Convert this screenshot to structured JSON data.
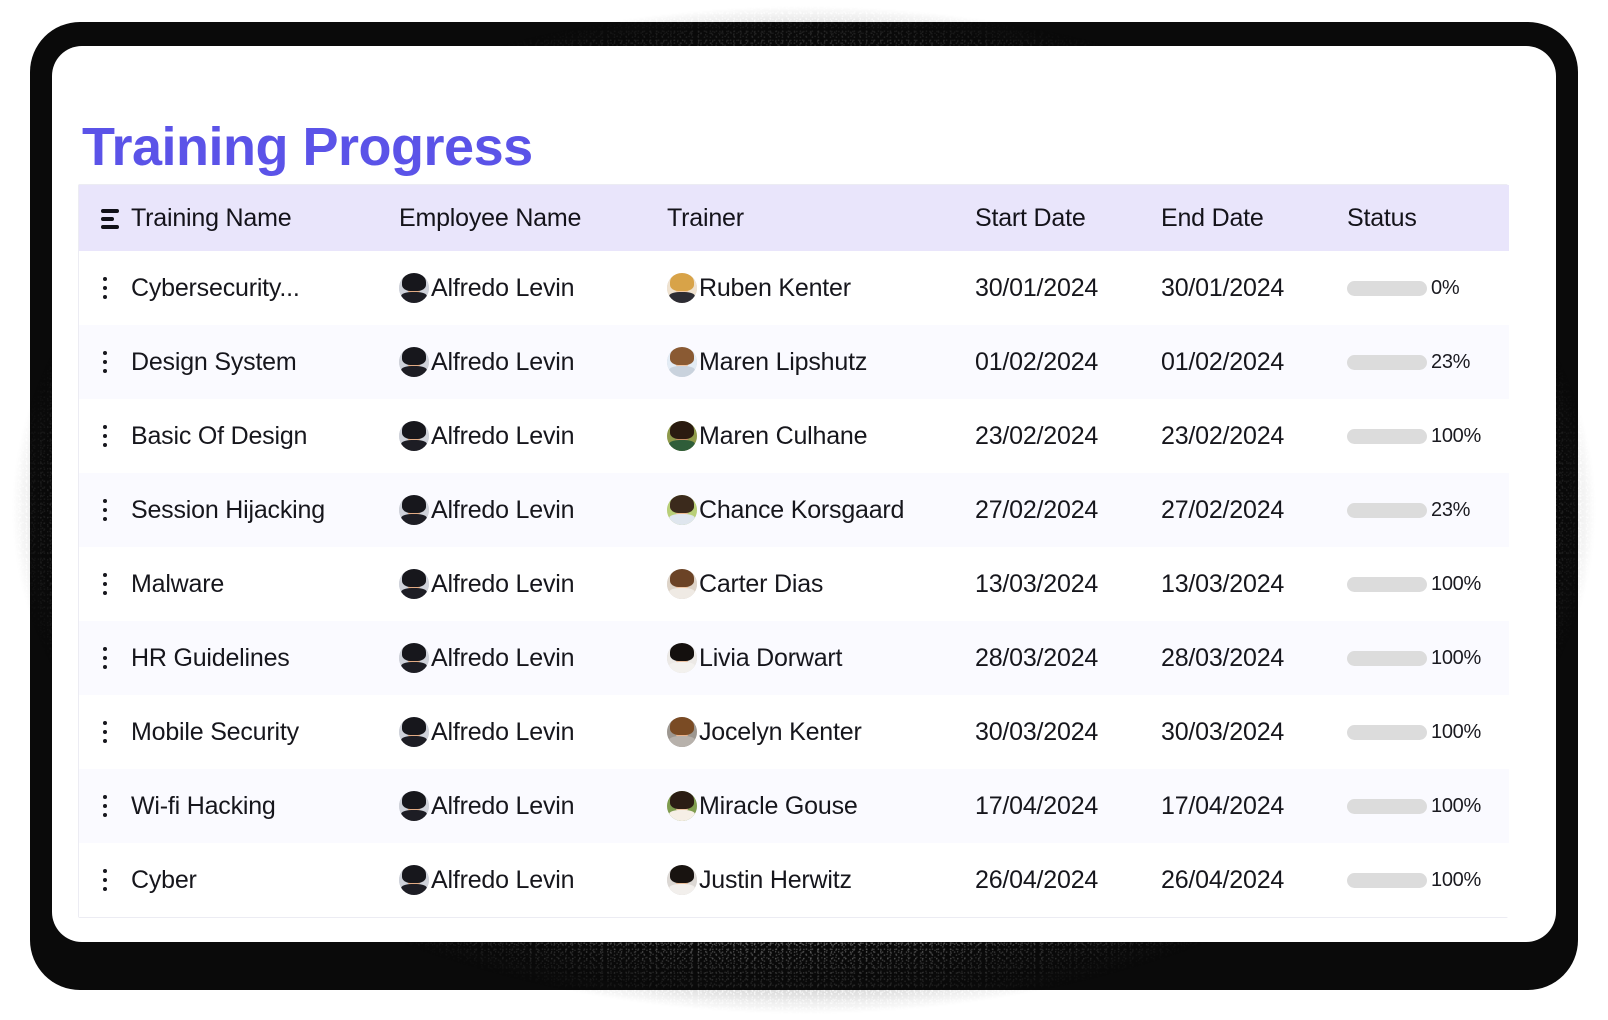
{
  "header": {
    "title": "Training Progress",
    "title_color": "#5b53e8"
  },
  "table": {
    "header_bg": "#e9e5fb",
    "sort_icon": "sort-lines-icon",
    "columns": [
      {
        "key": "handle",
        "label": ""
      },
      {
        "key": "training",
        "label": "Training Name"
      },
      {
        "key": "employee",
        "label": "Employee Name"
      },
      {
        "key": "trainer",
        "label": "Trainer"
      },
      {
        "key": "start",
        "label": "Start Date"
      },
      {
        "key": "end",
        "label": "End Date"
      },
      {
        "key": "status",
        "label": "Status"
      }
    ],
    "row_menu_icon": "kebab-menu-icon",
    "progress_colors": {
      "empty": "#dcdcdc",
      "partial": "#ffa800",
      "complete": "#22c91e"
    },
    "rows": [
      {
        "training": "Cybersecurity...",
        "employee": "Alfredo Levin",
        "trainer": "Ruben Kenter",
        "start": "30/01/2024",
        "end": "30/01/2024",
        "progress": 0,
        "progress_label": "0%",
        "bar_ratio": 0,
        "bar_color": "#dcdcdc",
        "emp_avatar": {
          "hair": "#17171c",
          "skin": "#e2ab84",
          "body": "#1d1d24",
          "bg": "#cfd2da"
        },
        "trainer_avatar": {
          "hair": "#d8a348",
          "skin": "#f1c9a4",
          "body": "#2c2c33",
          "bg": "#efe2cf"
        }
      },
      {
        "training": "Design System",
        "employee": "Alfredo Levin",
        "trainer": "Maren Lipshutz",
        "start": "01/02/2024",
        "end": "01/02/2024",
        "progress": 23,
        "progress_label": "23%",
        "bar_ratio": 0.52,
        "bar_color": "#ffa800",
        "emp_avatar": {
          "hair": "#17171c",
          "skin": "#e2ab84",
          "body": "#1d1d24",
          "bg": "#cfd2da"
        },
        "trainer_avatar": {
          "hair": "#8a5a33",
          "skin": "#f0c3a0",
          "body": "#c9d2dd",
          "bg": "#e3ecf5"
        }
      },
      {
        "training": "Basic Of Design",
        "employee": "Alfredo Levin",
        "trainer": "Maren Culhane",
        "start": "23/02/2024",
        "end": "23/02/2024",
        "progress": 100,
        "progress_label": "100%",
        "bar_ratio": 1,
        "bar_color": "#22c91e",
        "emp_avatar": {
          "hair": "#17171c",
          "skin": "#e2ab84",
          "body": "#1d1d24",
          "bg": "#cfd2da"
        },
        "trainer_avatar": {
          "hair": "#2a1b10",
          "skin": "#c48e62",
          "body": "#2f5d39",
          "bg": "#8f9a4a"
        }
      },
      {
        "training": "Session Hijacking",
        "employee": "Alfredo Levin",
        "trainer": "Chance Korsgaard",
        "start": "27/02/2024",
        "end": "27/02/2024",
        "progress": 23,
        "progress_label": "23%",
        "bar_ratio": 0.52,
        "bar_color": "#ffa800",
        "emp_avatar": {
          "hair": "#17171c",
          "skin": "#e2ab84",
          "body": "#1d1d24",
          "bg": "#cfd2da"
        },
        "trainer_avatar": {
          "hair": "#3b2a1c",
          "skin": "#eebb92",
          "body": "#dfe6ee",
          "bg": "#b9cf78"
        }
      },
      {
        "training": "Malware",
        "employee": "Alfredo Levin",
        "trainer": "Carter Dias",
        "start": "13/03/2024",
        "end": "13/03/2024",
        "progress": 100,
        "progress_label": "100%",
        "bar_ratio": 1,
        "bar_color": "#22c91e",
        "emp_avatar": {
          "hair": "#17171c",
          "skin": "#e2ab84",
          "body": "#1d1d24",
          "bg": "#cfd2da"
        },
        "trainer_avatar": {
          "hair": "#6b4326",
          "skin": "#f0c6a4",
          "body": "#efeae4",
          "bg": "#ded4c8"
        }
      },
      {
        "training": "HR Guidelines",
        "employee": "Alfredo Levin",
        "trainer": "Livia Dorwart",
        "start": "28/03/2024",
        "end": "28/03/2024",
        "progress": 100,
        "progress_label": "100%",
        "bar_ratio": 1,
        "bar_color": "#22c91e",
        "emp_avatar": {
          "hair": "#17171c",
          "skin": "#e2ab84",
          "body": "#1d1d24",
          "bg": "#cfd2da"
        },
        "trainer_avatar": {
          "hair": "#14100e",
          "skin": "#e9bfa0",
          "body": "#f3f1ee",
          "bg": "#ece9e6"
        }
      },
      {
        "training": "Mobile Security",
        "employee": "Alfredo Levin",
        "trainer": "Jocelyn Kenter",
        "start": "30/03/2024",
        "end": "30/03/2024",
        "progress": 100,
        "progress_label": "100%",
        "bar_ratio": 1,
        "bar_color": "#22c91e",
        "emp_avatar": {
          "hair": "#17171c",
          "skin": "#e2ab84",
          "body": "#1d1d24",
          "bg": "#cfd2da"
        },
        "trainer_avatar": {
          "hair": "#7a4b24",
          "skin": "#e8b089",
          "body": "#b7b1ab",
          "bg": "#9d9790"
        }
      },
      {
        "training": "Wi-fi Hacking",
        "employee": "Alfredo Levin",
        "trainer": "Miracle Gouse",
        "start": "17/04/2024",
        "end": "17/04/2024",
        "progress": 100,
        "progress_label": "100%",
        "bar_ratio": 1,
        "bar_color": "#22c91e",
        "emp_avatar": {
          "hair": "#17171c",
          "skin": "#e2ab84",
          "body": "#1d1d24",
          "bg": "#cfd2da"
        },
        "trainer_avatar": {
          "hair": "#2b1d14",
          "skin": "#eec4a1",
          "body": "#f6efe6",
          "bg": "#7f9c4e"
        }
      },
      {
        "training": "Cyber",
        "employee": "Alfredo Levin",
        "trainer": "Justin Herwitz",
        "start": "26/04/2024",
        "end": "26/04/2024",
        "progress": 100,
        "progress_label": "100%",
        "bar_ratio": 1,
        "bar_color": "#22c91e",
        "emp_avatar": {
          "hair": "#17171c",
          "skin": "#e2ab84",
          "body": "#1d1d24",
          "bg": "#cfd2da"
        },
        "trainer_avatar": {
          "hair": "#181310",
          "skin": "#e9bd99",
          "body": "#f2efec",
          "bg": "#dcd8d4"
        }
      }
    ]
  }
}
